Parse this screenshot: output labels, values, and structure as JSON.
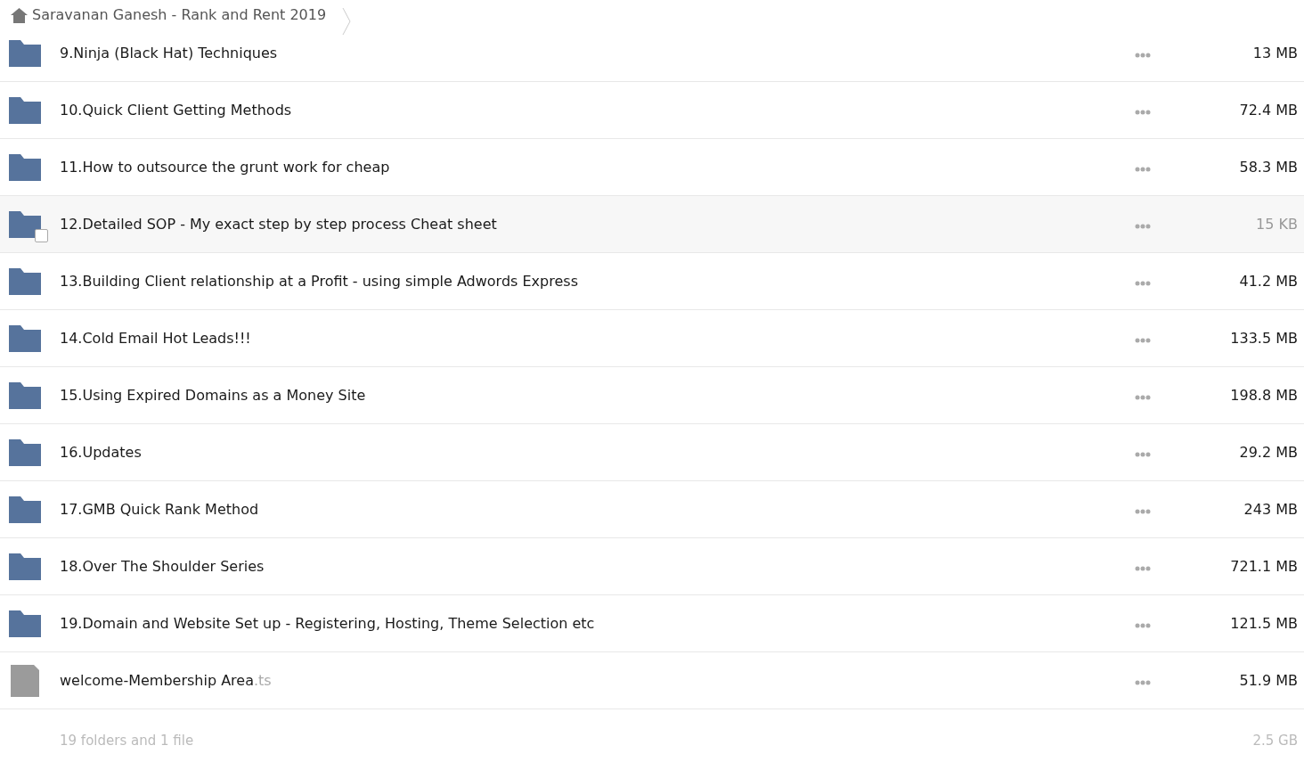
{
  "breadcrumb": {
    "label": "Saravanan Ganesh - Rank and Rent 2019"
  },
  "rows": [
    {
      "kind": "folder",
      "name": "9.Ninja (Black Hat) Techniques",
      "size": "13 MB",
      "hovered": false
    },
    {
      "kind": "folder",
      "name": "10.Quick Client Getting Methods",
      "size": "72.4 MB",
      "hovered": false
    },
    {
      "kind": "folder",
      "name": "11.How to outsource the grunt work for cheap",
      "size": "58.3 MB",
      "hovered": false
    },
    {
      "kind": "folder",
      "name": "12.Detailed SOP - My exact step by step process Cheat sheet",
      "size": "15 KB",
      "hovered": true
    },
    {
      "kind": "folder",
      "name": "13.Building Client relationship at a Profit - using simple Adwords Express",
      "size": "41.2 MB",
      "hovered": false
    },
    {
      "kind": "folder",
      "name": "14.Cold Email Hot Leads!!!",
      "size": "133.5 MB",
      "hovered": false
    },
    {
      "kind": "folder",
      "name": "15.Using Expired Domains as a Money Site",
      "size": "198.8 MB",
      "hovered": false
    },
    {
      "kind": "folder",
      "name": "16.Updates",
      "size": "29.2 MB",
      "hovered": false
    },
    {
      "kind": "folder",
      "name": "17.GMB Quick Rank Method",
      "size": "243 MB",
      "hovered": false
    },
    {
      "kind": "folder",
      "name": "18.Over The Shoulder Series",
      "size": "721.1 MB",
      "hovered": false
    },
    {
      "kind": "folder",
      "name": "19.Domain and Website Set up - Registering, Hosting, Theme Selection etc",
      "size": "121.5 MB",
      "hovered": false
    },
    {
      "kind": "file",
      "name": "welcome-Membership Area",
      "extension": ".ts",
      "size": "51.9 MB",
      "hovered": false
    }
  ],
  "summary": {
    "count": "19 folders and 1 file",
    "total": "2.5 GB"
  }
}
